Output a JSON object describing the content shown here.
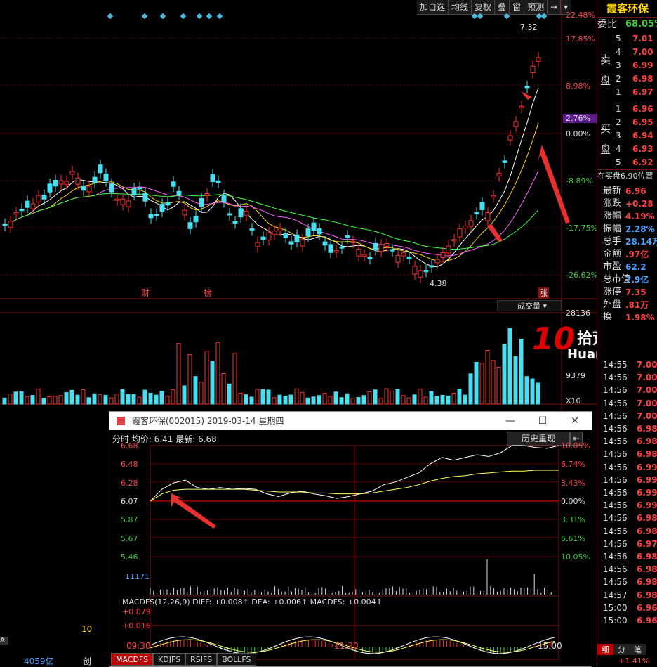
{
  "toolbar": {
    "items": [
      "加自选",
      "均线",
      "复权",
      "叠",
      "窗",
      "预测",
      "⇥"
    ]
  },
  "kline": {
    "pct_labels": [
      "22.48%",
      "17.85%",
      "8.98%",
      "2.76%",
      "0.00%",
      "-8.89%",
      "-17.75%",
      "-26.62%"
    ],
    "high_label": "7.32",
    "low_label": "4.38",
    "event_labels": [
      "财",
      "榜",
      "涨"
    ]
  },
  "volume": {
    "selector": "成交量",
    "ticks": [
      "28136",
      "9379"
    ],
    "unit": "X10"
  },
  "macd_left": {
    "tick": "10",
    "bottom": "4059亿",
    "a_label": "A",
    "chuang": "创"
  },
  "side": {
    "name": "霞客环保",
    "weibi_label": "委比",
    "weibi_value": "68.05%",
    "sell_label": [
      "卖",
      "盘"
    ],
    "buy_label": [
      "买",
      "盘"
    ],
    "asks": [
      {
        "n": "5",
        "p": "7.01"
      },
      {
        "n": "4",
        "p": "7.00"
      },
      {
        "n": "3",
        "p": "6.99"
      },
      {
        "n": "2",
        "p": "6.98"
      },
      {
        "n": "1",
        "p": "6.97"
      }
    ],
    "bids": [
      {
        "n": "1",
        "p": "6.96"
      },
      {
        "n": "2",
        "p": "6.95"
      },
      {
        "n": "3",
        "p": "6.94"
      },
      {
        "n": "4",
        "p": "6.93"
      },
      {
        "n": "5",
        "p": "6.92"
      }
    ],
    "zaimai": "在买盘6.90位置",
    "quote": [
      {
        "k": "最新",
        "v": "6.96"
      },
      {
        "k": "涨跌",
        "v": "+0.28"
      },
      {
        "k": "涨幅",
        "v": "4.19%"
      },
      {
        "k": "振幅",
        "v": "2.28%"
      },
      {
        "k": "总手",
        "v": "28.14万"
      },
      {
        "k": "金额",
        "v": ".97亿"
      },
      {
        "k": "市盈",
        "v": "62.2"
      },
      {
        "k": "总市值",
        "v": "7.9亿"
      },
      {
        "k": "涨停",
        "v": "7.35"
      },
      {
        "k": "外盘",
        "v": ".81万"
      },
      {
        "k": "换",
        "v": "1.98%"
      }
    ],
    "ticks": [
      {
        "t": "14:55",
        "p": "7.00"
      },
      {
        "t": "14:56",
        "p": "7.00"
      },
      {
        "t": "14:56",
        "p": "7.00"
      },
      {
        "t": "14:56",
        "p": "7.00"
      },
      {
        "t": "14:56",
        "p": "7.00"
      },
      {
        "t": "14:56",
        "p": "6.98"
      },
      {
        "t": "14:56",
        "p": "6.98"
      },
      {
        "t": "14:56",
        "p": "6.98"
      },
      {
        "t": "14:56",
        "p": "6.99"
      },
      {
        "t": "14:56",
        "p": "6.99"
      },
      {
        "t": "14:56",
        "p": "6.99"
      },
      {
        "t": "14:56",
        "p": "6.99"
      },
      {
        "t": "14:56",
        "p": "6.98"
      },
      {
        "t": "14:56",
        "p": "6.98"
      },
      {
        "t": "14:56",
        "p": "6.97"
      },
      {
        "t": "14:56",
        "p": "6.98"
      },
      {
        "t": "14:56",
        "p": "6.98"
      },
      {
        "t": "14:56",
        "p": "6.98"
      },
      {
        "t": "14:57",
        "p": "6.98"
      },
      {
        "t": "15:00",
        "p": "6.96"
      },
      {
        "t": "15:00",
        "p": "6.96"
      }
    ],
    "bottom_tabs": [
      "细",
      "分",
      "笔"
    ],
    "bottom_pct": "+1.41%"
  },
  "watermark": {
    "big": "10",
    "cn": "拾荒网",
    "url": "Huang.CN"
  },
  "popup": {
    "title": "霞客环保(002015) 2019-03-14 星期四",
    "buttons": [
      "—",
      "☐",
      "✕"
    ],
    "header": "分时 均价: 6.41 最新: 6.68",
    "replay": "历史重现",
    "macd_line": "MACDFS(12,26,9) DIFF: +0.008↑ DEA: +0.006↑ MACDFS: +0.004↑",
    "vol_tick": "11171"
  },
  "tabs": [
    "MACDFS",
    "KDJFS",
    "RSIFS",
    "BOLLFS"
  ],
  "chart_data": [
    {
      "type": "line",
      "title": "",
      "x": [
        "09:30",
        "11:30",
        "15:00"
      ],
      "price_ticks": [
        6.68,
        6.48,
        6.28,
        6.07,
        5.87,
        5.67,
        5.46
      ],
      "pct_ticks": [
        "10.05%",
        "6.74%",
        "3.43%",
        "0.00%",
        "3.31%",
        "6.61%",
        "10.05%"
      ],
      "prev_close": 6.07,
      "avg_price": 6.41,
      "last_price": 6.68,
      "ylim": [
        5.46,
        6.68
      ],
      "series": [
        {
          "values": [
            6.07,
            6.2,
            6.27,
            6.3,
            6.22,
            6.2,
            6.22,
            6.2,
            6.21,
            6.2,
            6.15,
            6.12,
            6.16,
            6.18,
            6.15,
            6.13,
            6.1,
            6.12,
            6.15,
            6.18,
            6.25,
            6.28,
            6.33,
            6.38,
            6.48,
            6.55,
            6.52,
            6.55,
            6.58,
            6.56,
            6.6,
            6.68,
            6.68,
            6.66,
            6.65,
            6.68
          ]
        },
        {
          "values": [
            6.07,
            6.15,
            6.19,
            6.2,
            6.2,
            6.2,
            6.2,
            6.2,
            6.2,
            6.19,
            6.18,
            6.17,
            6.17,
            6.17,
            6.16,
            6.16,
            6.15,
            6.15,
            6.15,
            6.16,
            6.18,
            6.2,
            6.22,
            6.25,
            6.29,
            6.32,
            6.34,
            6.35,
            6.37,
            6.38,
            6.39,
            6.4,
            6.4,
            6.41,
            6.41,
            6.41
          ]
        }
      ],
      "macd": {
        "diff": 0.008,
        "dea": 0.006,
        "macdfs": 0.004,
        "ticks": [
          "+0.079",
          "+0.016"
        ]
      }
    }
  ]
}
